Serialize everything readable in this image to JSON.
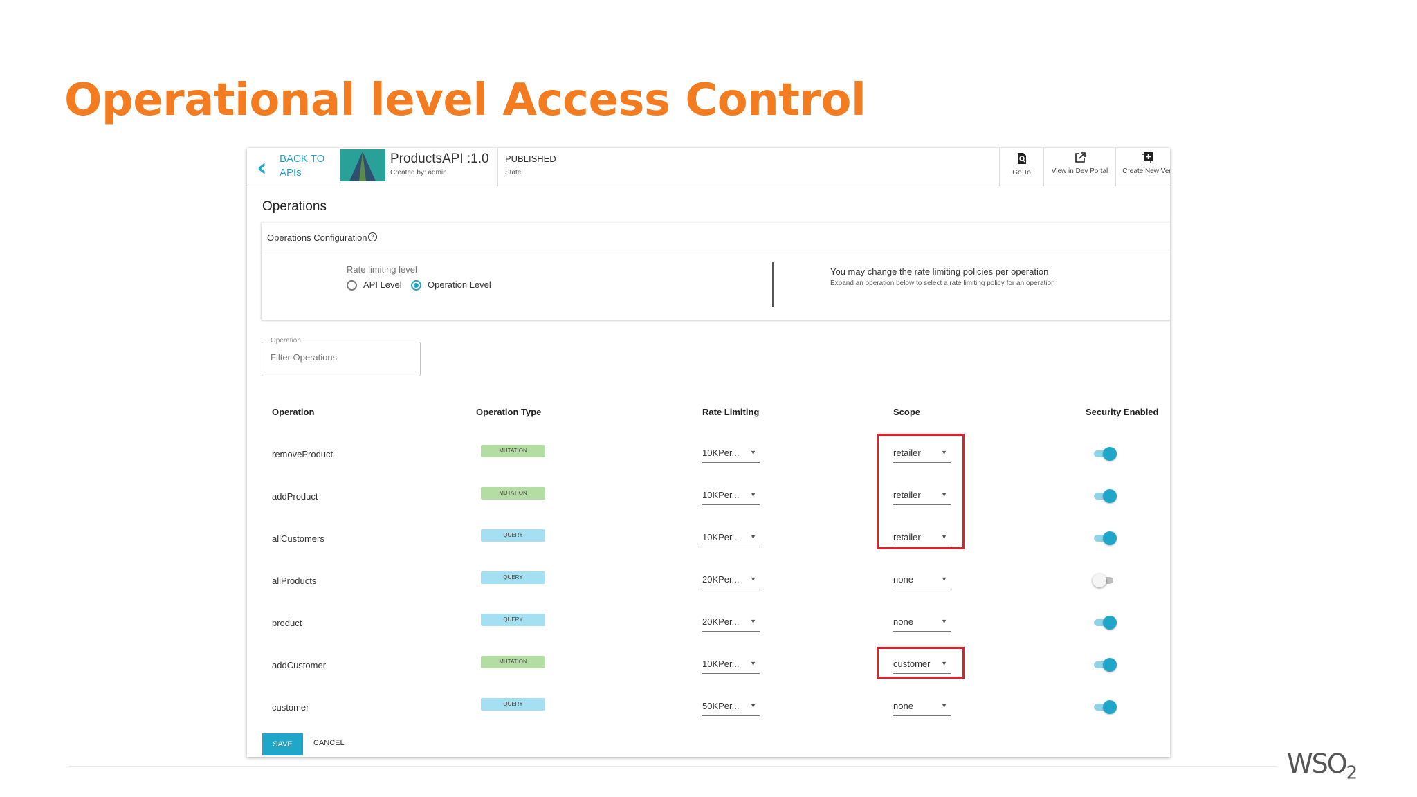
{
  "slide": {
    "title": "Operational level Access Control",
    "logo": "WSO",
    "logo_sub": "2"
  },
  "header": {
    "back_line1": "BACK TO",
    "back_line2": "APIs",
    "api_name": "ProductsAPI :1.0",
    "created_by": "Created by: admin",
    "state_value": "PUBLISHED",
    "state_label": "State",
    "actions": [
      {
        "label": "Go To",
        "icon": "search-doc-icon"
      },
      {
        "label": "View in Dev Portal",
        "icon": "external-link-icon"
      },
      {
        "label": "Create New Ver",
        "icon": "add-box-icon"
      }
    ]
  },
  "operations": {
    "title": "Operations",
    "config_title": "Operations Configuration",
    "rate_limiting_label": "Rate limiting level",
    "radio_api_level": "API Level",
    "radio_operation_level": "Operation Level",
    "selected_level": "Operation Level",
    "info_main": "You may change the rate limiting policies per operation",
    "info_sub": "Expand an operation below to select a rate limiting policy for an operation",
    "filter_label": "Operation",
    "filter_placeholder": "Filter Operations"
  },
  "table": {
    "headers": {
      "operation": "Operation",
      "operation_type": "Operation Type",
      "rate_limiting": "Rate Limiting",
      "scope": "Scope",
      "security_enabled": "Security Enabled"
    },
    "rows": [
      {
        "operation": "removeProduct",
        "type": "MUTATION",
        "rate": "10KPer...",
        "scope": "retailer",
        "security": true
      },
      {
        "operation": "addProduct",
        "type": "MUTATION",
        "rate": "10KPer...",
        "scope": "retailer",
        "security": true
      },
      {
        "operation": "allCustomers",
        "type": "QUERY",
        "rate": "10KPer...",
        "scope": "retailer",
        "security": true
      },
      {
        "operation": "allProducts",
        "type": "QUERY",
        "rate": "20KPer...",
        "scope": "none",
        "security": false
      },
      {
        "operation": "product",
        "type": "QUERY",
        "rate": "20KPer...",
        "scope": "none",
        "security": true
      },
      {
        "operation": "addCustomer",
        "type": "MUTATION",
        "rate": "10KPer...",
        "scope": "customer",
        "security": true
      },
      {
        "operation": "customer",
        "type": "QUERY",
        "rate": "50KPer...",
        "scope": "none",
        "security": true
      }
    ]
  },
  "buttons": {
    "save": "SAVE",
    "cancel": "CANCEL"
  },
  "colors": {
    "title_orange": "#f47c20",
    "accent_teal": "#1fa6c8",
    "mutation_badge": "#b4dda3",
    "query_badge": "#a4e0f1",
    "highlight_red": "#e0202a"
  }
}
